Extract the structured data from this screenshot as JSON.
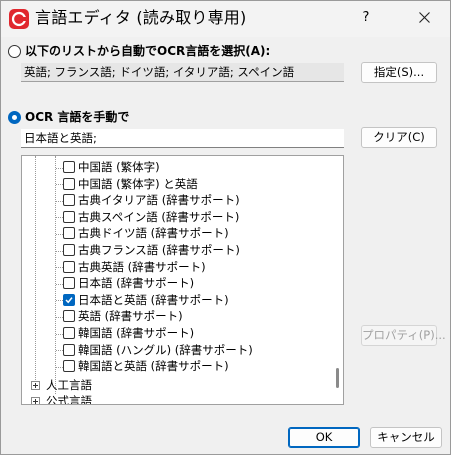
{
  "window": {
    "title": "言語エディタ (読み取り専用)",
    "help_label": "?"
  },
  "auto_select": {
    "label": "以下のリストから自動でOCR言語を選択(A):",
    "value": "英語; フランス語; ドイツ語; イタリア語; スペイン語",
    "button_label": "指定(S)...",
    "selected": false
  },
  "manual_select": {
    "label": "OCR 言語を手動で",
    "value": "日本語と英語;",
    "button_label": "クリア(C)",
    "selected": true
  },
  "tree": {
    "items": [
      {
        "label": "中国語 (繁体字)",
        "checked": false
      },
      {
        "label": "中国語 (繁体字) と英語",
        "checked": false
      },
      {
        "label": "古典イタリア語 (辞書サポート)",
        "checked": false
      },
      {
        "label": "古典スペイン語 (辞書サポート)",
        "checked": false
      },
      {
        "label": "古典ドイツ語 (辞書サポート)",
        "checked": false
      },
      {
        "label": "古典フランス語 (辞書サポート)",
        "checked": false
      },
      {
        "label": "古典英語 (辞書サポート)",
        "checked": false
      },
      {
        "label": "日本語 (辞書サポート)",
        "checked": false
      },
      {
        "label": "日本語と英語 (辞書サポート)",
        "checked": true
      },
      {
        "label": "英語 (辞書サポート)",
        "checked": false
      },
      {
        "label": "韓国語 (辞書サポート)",
        "checked": false
      },
      {
        "label": "韓国語 (ハングル) (辞書サポート)",
        "checked": false
      },
      {
        "label": "韓国語と英語 (辞書サポート)",
        "checked": false
      }
    ],
    "groups": [
      {
        "label": "人工言語"
      },
      {
        "label": "公式言語"
      }
    ]
  },
  "properties_button": "プロパティ(P)...",
  "ok_button": "OK",
  "cancel_button": "キャンセル",
  "colors": {
    "accent": "#0067c0",
    "app_icon": "#e0272e"
  }
}
